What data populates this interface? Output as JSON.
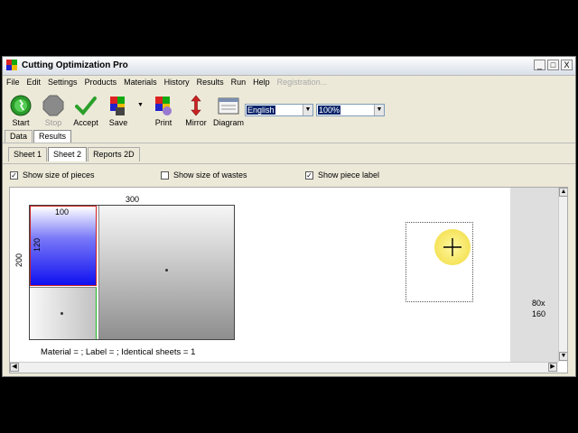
{
  "window": {
    "title": "Cutting Optimization Pro",
    "controls": {
      "minimize": "_",
      "maximize": "□",
      "close": "X"
    }
  },
  "menu": [
    "File",
    "Edit",
    "Settings",
    "Products",
    "Materials",
    "History",
    "Results",
    "Run",
    "Help",
    "Registration..."
  ],
  "toolbar": {
    "start": "Start",
    "stop": "Stop",
    "accept": "Accept",
    "save": "Save",
    "print": "Print",
    "mirror": "Mirror",
    "diagram": "Diagram",
    "language": "English",
    "zoom": "100%"
  },
  "tabs": {
    "main": [
      "Data",
      "Results"
    ],
    "sheets": [
      "Sheet 1",
      "Sheet 2",
      "Reports 2D"
    ]
  },
  "options": {
    "show_size_pieces": "Show size of pieces",
    "show_size_wastes": "Show size of wastes",
    "show_piece_label": "Show piece label"
  },
  "sheet": {
    "top_dim": "300",
    "left_dim": "200",
    "piece_width": "100",
    "piece_height": "120",
    "footer": "Material =  ; Label =  ; Identical sheets  = 1"
  },
  "side_piece": {
    "width": "80x",
    "height": "160"
  },
  "colors": {
    "piece_blue": "#1010f0",
    "accent_red": "#cc2222",
    "title_bg": "#dde3ec"
  }
}
